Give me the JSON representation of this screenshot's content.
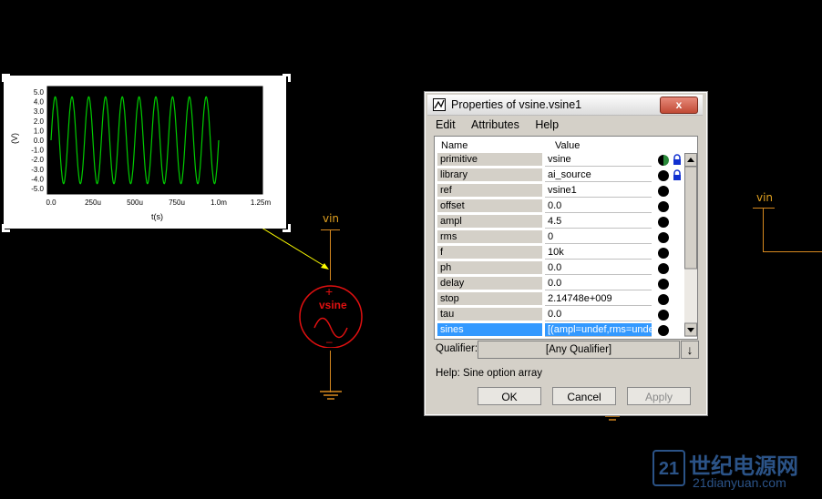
{
  "schematic": {
    "net_label_left": "vin",
    "net_label_right": "vin",
    "source_label": "vsine",
    "plus_sign": "+",
    "minus_sign": "–"
  },
  "plot": {
    "ylabel": "(V)",
    "xlabel": "t(s)",
    "yticks": [
      "5.0",
      "4.0",
      "3.0",
      "2.0",
      "1.0",
      "0.0",
      "-1.0",
      "-2.0",
      "-3.0",
      "-4.0",
      "-5.0"
    ],
    "xticks": [
      "0.0",
      "250u",
      "500u",
      "750u",
      "1.0m",
      "1.25m"
    ],
    "trace_color": "#00cc00"
  },
  "dialog": {
    "title": "Properties of vsine.vsine1",
    "close_label": "x",
    "menu": [
      "Edit",
      "Attributes",
      "Help"
    ],
    "col_name": "Name",
    "col_value": "Value",
    "rows": [
      {
        "name": "primitive",
        "value": "vsine"
      },
      {
        "name": "library",
        "value": "ai_source"
      },
      {
        "name": "ref",
        "value": "vsine1"
      },
      {
        "name": "offset",
        "value": "0.0"
      },
      {
        "name": "ampl",
        "value": "4.5"
      },
      {
        "name": "rms",
        "value": "0"
      },
      {
        "name": "f",
        "value": "10k"
      },
      {
        "name": "ph",
        "value": "0.0"
      },
      {
        "name": "delay",
        "value": "0.0"
      },
      {
        "name": "stop",
        "value": "2.14748e+009"
      },
      {
        "name": "tau",
        "value": "0.0"
      },
      {
        "name": "sines",
        "value": "[(ampl=undef,rms=undef"
      }
    ],
    "qualifier_label": "Qualifier:",
    "qualifier_value": "[Any Qualifier]",
    "help_text": "Help:  Sine option array",
    "ok_label": "OK",
    "cancel_label": "Cancel",
    "apply_label": "Apply"
  },
  "watermark": {
    "text_cn": "世纪电源网",
    "text_url": "21dianyuan.com"
  }
}
